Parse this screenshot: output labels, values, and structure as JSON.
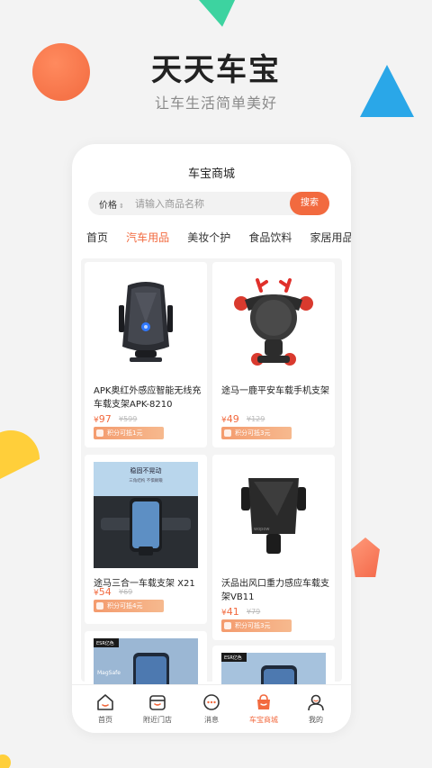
{
  "hero": {
    "title": "天天车宝",
    "subtitle": "让车生活简单美好"
  },
  "shop": {
    "title": "车宝商城"
  },
  "search": {
    "filter_label": "价格",
    "placeholder": "请输入商品名称",
    "button_label": "搜索"
  },
  "tabs": [
    {
      "label": "首页"
    },
    {
      "label": "汽车用品"
    },
    {
      "label": "美妆个护"
    },
    {
      "label": "食品饮料"
    },
    {
      "label": "家居用品"
    }
  ],
  "active_tab": "汽车用品",
  "products": [
    {
      "name": "APK奥红外感应智能无线充车载支架APK-8210",
      "price": "97",
      "old_price": "¥599",
      "points": "积分可抵1元"
    },
    {
      "name": "途马一鹿平安车载手机支架",
      "price": "49",
      "old_price": "¥129",
      "points": "积分可抵3元"
    },
    {
      "name": "途马三合一车载支架 X21",
      "price": "54",
      "old_price": "¥69",
      "points": "积分可抵4元"
    },
    {
      "name": "沃品出风口重力感应车载支架VB11",
      "price": "41",
      "old_price": "¥79",
      "points": "积分可抵3元"
    }
  ],
  "currency": "¥",
  "promo_images": {
    "card3_line1": "稳固不晃动",
    "card3_line2": "三角结构 不惧颠簸",
    "card4_brand": "wopow",
    "card5_brand": "ESR亿色",
    "card5_text": "MagSafe",
    "card6_brand": "ESR亿色"
  },
  "bottom_nav": [
    {
      "label": "首页",
      "icon": "home-icon"
    },
    {
      "label": "附近门店",
      "icon": "store-icon"
    },
    {
      "label": "消息",
      "icon": "message-icon"
    },
    {
      "label": "车宝商城",
      "icon": "shop-bag-icon"
    },
    {
      "label": "我的",
      "icon": "profile-icon"
    }
  ],
  "active_nav": "车宝商城",
  "colors": {
    "accent": "#f26a3f",
    "background": "#f3f3f3"
  }
}
